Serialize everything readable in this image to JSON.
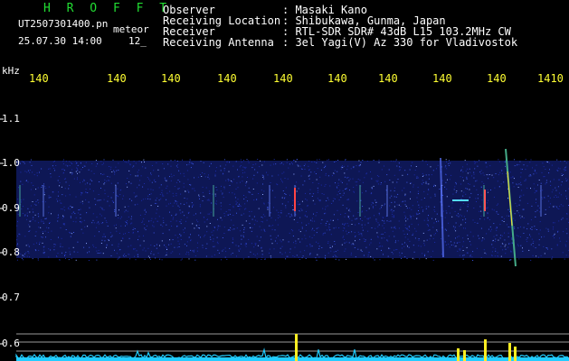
{
  "header": {
    "title": "H R O F F T",
    "filename": "UT2507301400.pn",
    "mode": "meteor",
    "datetime": "25.07.30 14:00",
    "count": "12_"
  },
  "station": [
    {
      "label": "Observer",
      "value": ": Masaki Kano"
    },
    {
      "label": "Receiving Location",
      "value": ": Shibukawa, Gunma, Japan"
    },
    {
      "label": "Receiver",
      "value": ": RTL-SDR SDR# 43dB L15 103.2MHz CW"
    },
    {
      "label": "Receiving Antenna",
      "value": ": 3el Yagi(V) Az 330 for Vladivostok"
    }
  ],
  "axis": {
    "unit": "kHz",
    "y_ticks": [
      "1.1",
      "1.0",
      "0.9",
      "0.8",
      "0.7",
      "0.6"
    ],
    "x_ticks": [
      "140",
      "140",
      "140",
      "140",
      "140",
      "140",
      "140",
      "140",
      "140",
      "1410"
    ]
  },
  "colors": {
    "background": "#000000",
    "title": "#22dd33",
    "freq_labels": "#ffff33",
    "noise_band": "#1a2a9a",
    "level_trace": "#22ccff",
    "level_peaks": "#ffee22"
  }
}
